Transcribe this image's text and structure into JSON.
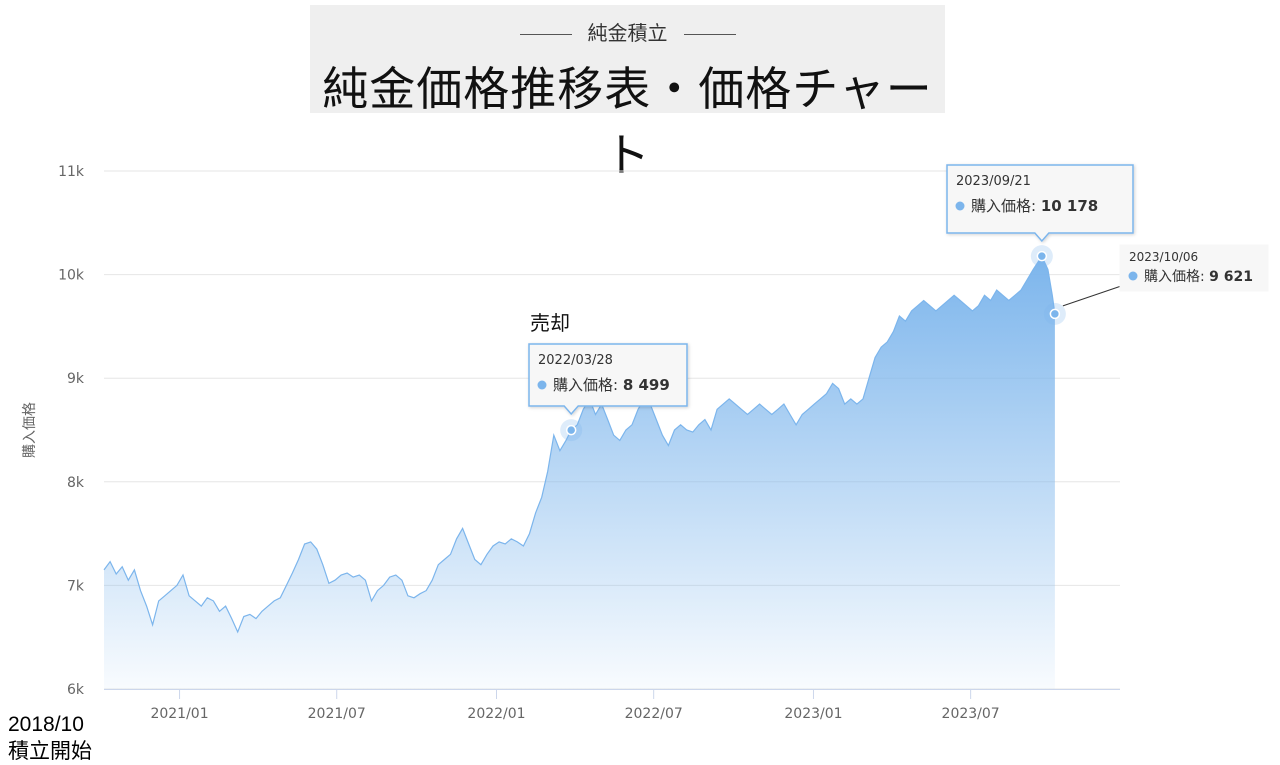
{
  "header": {
    "subtitle": "純金積立",
    "title": "純金価格推移表・価格チャート"
  },
  "start_note": {
    "date": "2018/10",
    "label": "積立開始"
  },
  "annotation_label": "売却",
  "colors": {
    "area_top": "#7cb5ec",
    "line": "#7cb5ec",
    "grid": "#e6e6e6",
    "axis": "#ccd6eb"
  },
  "chart_data": {
    "type": "area",
    "ylabel": "購入価格",
    "xlabel": "",
    "ylim": [
      6000,
      11000
    ],
    "yticks": [
      {
        "value": 6000,
        "label": "6k"
      },
      {
        "value": 7000,
        "label": "7k"
      },
      {
        "value": 8000,
        "label": "8k"
      },
      {
        "value": 9000,
        "label": "9k"
      },
      {
        "value": 10000,
        "label": "10k"
      },
      {
        "value": 11000,
        "label": "11k"
      }
    ],
    "xrange": [
      "2020-10-06",
      "2023-12-20"
    ],
    "xticks": [
      {
        "date": "2021-01-01",
        "label": "2021/01"
      },
      {
        "date": "2021-07-01",
        "label": "2021/07"
      },
      {
        "date": "2022-01-01",
        "label": "2022/01"
      },
      {
        "date": "2022-07-01",
        "label": "2022/07"
      },
      {
        "date": "2023-01-01",
        "label": "2023/01"
      },
      {
        "date": "2023-07-01",
        "label": "2023/07"
      }
    ],
    "series": [
      {
        "name": "購入価格",
        "points": [
          [
            "2020-10-06",
            7150
          ],
          [
            "2020-10-13",
            7230
          ],
          [
            "2020-10-20",
            7110
          ],
          [
            "2020-10-27",
            7180
          ],
          [
            "2020-11-03",
            7050
          ],
          [
            "2020-11-10",
            7150
          ],
          [
            "2020-11-17",
            6950
          ],
          [
            "2020-11-24",
            6800
          ],
          [
            "2020-12-01",
            6620
          ],
          [
            "2020-12-08",
            6850
          ],
          [
            "2020-12-15",
            6900
          ],
          [
            "2020-12-22",
            6950
          ],
          [
            "2020-12-29",
            7000
          ],
          [
            "2021-01-05",
            7100
          ],
          [
            "2021-01-12",
            6900
          ],
          [
            "2021-01-19",
            6850
          ],
          [
            "2021-01-26",
            6800
          ],
          [
            "2021-02-02",
            6880
          ],
          [
            "2021-02-09",
            6850
          ],
          [
            "2021-02-16",
            6750
          ],
          [
            "2021-02-23",
            6800
          ],
          [
            "2021-03-02",
            6680
          ],
          [
            "2021-03-09",
            6550
          ],
          [
            "2021-03-16",
            6700
          ],
          [
            "2021-03-23",
            6720
          ],
          [
            "2021-03-30",
            6680
          ],
          [
            "2021-04-06",
            6750
          ],
          [
            "2021-04-13",
            6800
          ],
          [
            "2021-04-20",
            6850
          ],
          [
            "2021-04-27",
            6880
          ],
          [
            "2021-05-04",
            7000
          ],
          [
            "2021-05-11",
            7120
          ],
          [
            "2021-05-18",
            7250
          ],
          [
            "2021-05-25",
            7400
          ],
          [
            "2021-06-01",
            7420
          ],
          [
            "2021-06-08",
            7350
          ],
          [
            "2021-06-15",
            7200
          ],
          [
            "2021-06-22",
            7020
          ],
          [
            "2021-06-29",
            7050
          ],
          [
            "2021-07-06",
            7100
          ],
          [
            "2021-07-13",
            7120
          ],
          [
            "2021-07-20",
            7080
          ],
          [
            "2021-07-27",
            7100
          ],
          [
            "2021-08-03",
            7050
          ],
          [
            "2021-08-10",
            6850
          ],
          [
            "2021-08-17",
            6950
          ],
          [
            "2021-08-24",
            7000
          ],
          [
            "2021-08-31",
            7080
          ],
          [
            "2021-09-07",
            7100
          ],
          [
            "2021-09-14",
            7050
          ],
          [
            "2021-09-21",
            6900
          ],
          [
            "2021-09-28",
            6880
          ],
          [
            "2021-10-05",
            6920
          ],
          [
            "2021-10-12",
            6950
          ],
          [
            "2021-10-19",
            7050
          ],
          [
            "2021-10-26",
            7200
          ],
          [
            "2021-11-02",
            7250
          ],
          [
            "2021-11-09",
            7300
          ],
          [
            "2021-11-16",
            7450
          ],
          [
            "2021-11-23",
            7550
          ],
          [
            "2021-11-30",
            7400
          ],
          [
            "2021-12-07",
            7250
          ],
          [
            "2021-12-14",
            7200
          ],
          [
            "2021-12-21",
            7300
          ],
          [
            "2021-12-28",
            7380
          ],
          [
            "2022-01-04",
            7420
          ],
          [
            "2022-01-11",
            7400
          ],
          [
            "2022-01-18",
            7450
          ],
          [
            "2022-01-25",
            7420
          ],
          [
            "2022-02-01",
            7380
          ],
          [
            "2022-02-08",
            7500
          ],
          [
            "2022-02-15",
            7700
          ],
          [
            "2022-02-22",
            7850
          ],
          [
            "2022-03-01",
            8100
          ],
          [
            "2022-03-08",
            8450
          ],
          [
            "2022-03-15",
            8300
          ],
          [
            "2022-03-22",
            8400
          ],
          [
            "2022-03-28",
            8499
          ],
          [
            "2022-04-04",
            8550
          ],
          [
            "2022-04-11",
            8700
          ],
          [
            "2022-04-18",
            8800
          ],
          [
            "2022-04-25",
            8650
          ],
          [
            "2022-05-02",
            8750
          ],
          [
            "2022-05-09",
            8600
          ],
          [
            "2022-05-16",
            8450
          ],
          [
            "2022-05-23",
            8400
          ],
          [
            "2022-05-30",
            8500
          ],
          [
            "2022-06-06",
            8550
          ],
          [
            "2022-06-13",
            8700
          ],
          [
            "2022-06-20",
            8800
          ],
          [
            "2022-06-27",
            8750
          ],
          [
            "2022-07-04",
            8600
          ],
          [
            "2022-07-11",
            8450
          ],
          [
            "2022-07-18",
            8350
          ],
          [
            "2022-07-25",
            8500
          ],
          [
            "2022-08-01",
            8550
          ],
          [
            "2022-08-08",
            8500
          ],
          [
            "2022-08-15",
            8480
          ],
          [
            "2022-08-22",
            8550
          ],
          [
            "2022-08-29",
            8600
          ],
          [
            "2022-09-05",
            8500
          ],
          [
            "2022-09-12",
            8700
          ],
          [
            "2022-09-19",
            8750
          ],
          [
            "2022-09-26",
            8800
          ],
          [
            "2022-10-03",
            8750
          ],
          [
            "2022-10-10",
            8700
          ],
          [
            "2022-10-17",
            8650
          ],
          [
            "2022-10-24",
            8700
          ],
          [
            "2022-10-31",
            8750
          ],
          [
            "2022-11-07",
            8700
          ],
          [
            "2022-11-14",
            8650
          ],
          [
            "2022-11-21",
            8700
          ],
          [
            "2022-11-28",
            8750
          ],
          [
            "2022-12-05",
            8650
          ],
          [
            "2022-12-12",
            8550
          ],
          [
            "2022-12-19",
            8650
          ],
          [
            "2022-12-26",
            8700
          ],
          [
            "2023-01-02",
            8750
          ],
          [
            "2023-01-09",
            8800
          ],
          [
            "2023-01-16",
            8850
          ],
          [
            "2023-01-23",
            8950
          ],
          [
            "2023-01-30",
            8900
          ],
          [
            "2023-02-06",
            8750
          ],
          [
            "2023-02-13",
            8800
          ],
          [
            "2023-02-20",
            8750
          ],
          [
            "2023-02-27",
            8800
          ],
          [
            "2023-03-06",
            9000
          ],
          [
            "2023-03-13",
            9200
          ],
          [
            "2023-03-20",
            9300
          ],
          [
            "2023-03-27",
            9350
          ],
          [
            "2023-04-03",
            9450
          ],
          [
            "2023-04-10",
            9600
          ],
          [
            "2023-04-17",
            9550
          ],
          [
            "2023-04-24",
            9650
          ],
          [
            "2023-05-01",
            9700
          ],
          [
            "2023-05-08",
            9750
          ],
          [
            "2023-05-15",
            9700
          ],
          [
            "2023-05-22",
            9650
          ],
          [
            "2023-05-29",
            9700
          ],
          [
            "2023-06-05",
            9750
          ],
          [
            "2023-06-12",
            9800
          ],
          [
            "2023-06-19",
            9750
          ],
          [
            "2023-06-26",
            9700
          ],
          [
            "2023-07-03",
            9650
          ],
          [
            "2023-07-10",
            9700
          ],
          [
            "2023-07-17",
            9800
          ],
          [
            "2023-07-24",
            9750
          ],
          [
            "2023-07-31",
            9850
          ],
          [
            "2023-08-07",
            9800
          ],
          [
            "2023-08-14",
            9750
          ],
          [
            "2023-08-21",
            9800
          ],
          [
            "2023-08-28",
            9850
          ],
          [
            "2023-09-04",
            9950
          ],
          [
            "2023-09-11",
            10050
          ],
          [
            "2023-09-21",
            10178
          ],
          [
            "2023-09-28",
            10050
          ],
          [
            "2023-10-03",
            9800
          ],
          [
            "2023-10-06",
            9621
          ]
        ]
      }
    ],
    "tooltips": [
      {
        "date": "2022-03-28",
        "date_label": "2022/03/28",
        "series": "購入価格",
        "value": 8499,
        "value_label": "8 499"
      },
      {
        "date": "2023-09-21",
        "date_label": "2023/09/21",
        "series": "購入価格",
        "value": 10178,
        "value_label": "10 178"
      },
      {
        "date": "2023-10-06",
        "date_label": "2023/10/06",
        "series": "購入価格",
        "value": 9621,
        "value_label": "9 621"
      }
    ],
    "grid": true,
    "legend": "none"
  }
}
